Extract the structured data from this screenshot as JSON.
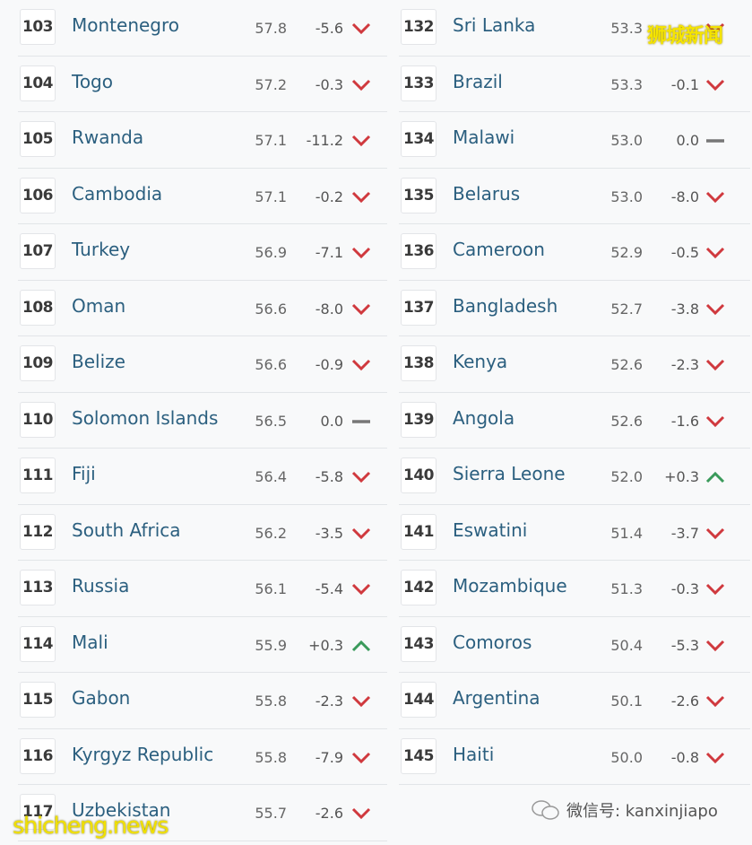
{
  "left_rows": [
    {
      "rank": "103",
      "country": "Montenegro",
      "score": "57.8",
      "change": "-5.6",
      "trend": "down"
    },
    {
      "rank": "104",
      "country": "Togo",
      "score": "57.2",
      "change": "-0.3",
      "trend": "down"
    },
    {
      "rank": "105",
      "country": "Rwanda",
      "score": "57.1",
      "change": "-11.2",
      "trend": "down"
    },
    {
      "rank": "106",
      "country": "Cambodia",
      "score": "57.1",
      "change": "-0.2",
      "trend": "down"
    },
    {
      "rank": "107",
      "country": "Turkey",
      "score": "56.9",
      "change": "-7.1",
      "trend": "down"
    },
    {
      "rank": "108",
      "country": "Oman",
      "score": "56.6",
      "change": "-8.0",
      "trend": "down"
    },
    {
      "rank": "109",
      "country": "Belize",
      "score": "56.6",
      "change": "-0.9",
      "trend": "down"
    },
    {
      "rank": "110",
      "country": "Solomon Islands",
      "score": "56.5",
      "change": "0.0",
      "trend": "flat"
    },
    {
      "rank": "111",
      "country": "Fiji",
      "score": "56.4",
      "change": "-5.8",
      "trend": "down"
    },
    {
      "rank": "112",
      "country": "South Africa",
      "score": "56.2",
      "change": "-3.5",
      "trend": "down"
    },
    {
      "rank": "113",
      "country": "Russia",
      "score": "56.1",
      "change": "-5.4",
      "trend": "down"
    },
    {
      "rank": "114",
      "country": "Mali",
      "score": "55.9",
      "change": "+0.3",
      "trend": "up"
    },
    {
      "rank": "115",
      "country": "Gabon",
      "score": "55.8",
      "change": "-2.3",
      "trend": "down"
    },
    {
      "rank": "116",
      "country": "Kyrgyz Republic",
      "score": "55.8",
      "change": "-7.9",
      "trend": "down"
    },
    {
      "rank": "117",
      "country": "Uzbekistan",
      "score": "55.7",
      "change": "-2.6",
      "trend": "down"
    }
  ],
  "right_rows": [
    {
      "rank": "132",
      "country": "Sri Lanka",
      "score": "53.3",
      "change": "",
      "trend": "down"
    },
    {
      "rank": "133",
      "country": "Brazil",
      "score": "53.3",
      "change": "-0.1",
      "trend": "down"
    },
    {
      "rank": "134",
      "country": "Malawi",
      "score": "53.0",
      "change": "0.0",
      "trend": "flat"
    },
    {
      "rank": "135",
      "country": "Belarus",
      "score": "53.0",
      "change": "-8.0",
      "trend": "down"
    },
    {
      "rank": "136",
      "country": "Cameroon",
      "score": "52.9",
      "change": "-0.5",
      "trend": "down"
    },
    {
      "rank": "137",
      "country": "Bangladesh",
      "score": "52.7",
      "change": "-3.8",
      "trend": "down"
    },
    {
      "rank": "138",
      "country": "Kenya",
      "score": "52.6",
      "change": "-2.3",
      "trend": "down"
    },
    {
      "rank": "139",
      "country": "Angola",
      "score": "52.6",
      "change": "-1.6",
      "trend": "down"
    },
    {
      "rank": "140",
      "country": "Sierra Leone",
      "score": "52.0",
      "change": "+0.3",
      "trend": "up"
    },
    {
      "rank": "141",
      "country": "Eswatini",
      "score": "51.4",
      "change": "-3.7",
      "trend": "down"
    },
    {
      "rank": "142",
      "country": "Mozambique",
      "score": "51.3",
      "change": "-0.3",
      "trend": "down"
    },
    {
      "rank": "143",
      "country": "Comoros",
      "score": "50.4",
      "change": "-5.3",
      "trend": "down"
    },
    {
      "rank": "144",
      "country": "Argentina",
      "score": "50.1",
      "change": "-2.6",
      "trend": "down"
    },
    {
      "rank": "145",
      "country": "Haiti",
      "score": "50.0",
      "change": "-0.8",
      "trend": "down"
    }
  ],
  "watermarks": {
    "top": "狮城新闻",
    "bottom_left": "shicheng.news",
    "wechat": "微信号: kanxinjiapo"
  },
  "colors": {
    "down": "#d0393e",
    "up": "#3a9a5b",
    "flat": "#777777",
    "country": "#2b5f7f"
  }
}
